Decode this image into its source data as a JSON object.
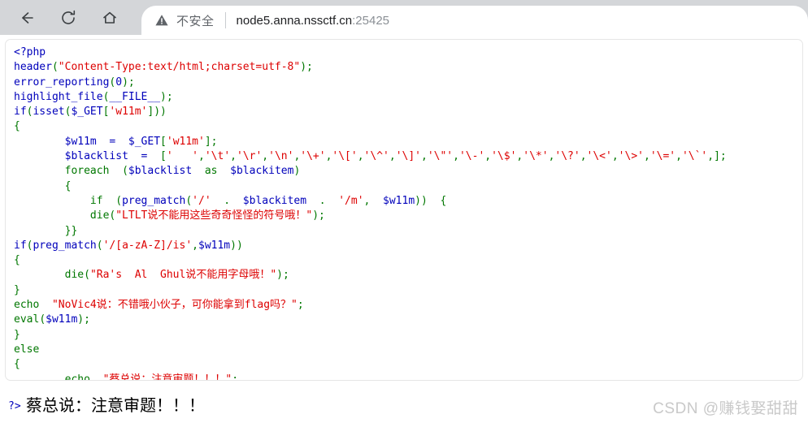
{
  "browser": {
    "back_label": "Back",
    "reload_label": "Reload",
    "home_label": "Home",
    "security_label": "不安全",
    "url_host": "node5.anna.nssctf.cn",
    "url_port": ":25425"
  },
  "code": {
    "lines": [
      [
        {
          "t": "<?php",
          "c": "kw"
        }
      ],
      [
        {
          "t": "header",
          "c": "kw"
        },
        {
          "t": "(",
          "c": "pun"
        },
        {
          "t": "\"Content-Type:text/html;charset=utf-8\"",
          "c": "str"
        },
        {
          "t": ")",
          "c": "pun"
        },
        {
          "t": ";",
          "c": "pun"
        }
      ],
      [
        {
          "t": "error_reporting",
          "c": "kw"
        },
        {
          "t": "(",
          "c": "pun"
        },
        {
          "t": "0",
          "c": "kw"
        },
        {
          "t": ")",
          "c": "pun"
        },
        {
          "t": ";",
          "c": "pun"
        }
      ],
      [
        {
          "t": "highlight_file",
          "c": "kw"
        },
        {
          "t": "(",
          "c": "pun"
        },
        {
          "t": "__FILE__",
          "c": "kw"
        },
        {
          "t": ")",
          "c": "pun"
        },
        {
          "t": ";",
          "c": "pun"
        }
      ],
      [
        {
          "t": "if",
          "c": "kw"
        },
        {
          "t": "(",
          "c": "pun"
        },
        {
          "t": "isset",
          "c": "kw"
        },
        {
          "t": "(",
          "c": "pun"
        },
        {
          "t": "$_GET",
          "c": "var"
        },
        {
          "t": "[",
          "c": "pun"
        },
        {
          "t": "'w11m'",
          "c": "str"
        },
        {
          "t": "]",
          "c": "pun"
        },
        {
          "t": "))",
          "c": "pun"
        }
      ],
      [
        {
          "t": "{",
          "c": "pun"
        }
      ],
      [
        {
          "t": "        ",
          "c": "kw"
        },
        {
          "t": "$w11m",
          "c": "var"
        },
        {
          "t": "  =  ",
          "c": "kw"
        },
        {
          "t": "$_GET",
          "c": "var"
        },
        {
          "t": "[",
          "c": "pun"
        },
        {
          "t": "'w11m'",
          "c": "str"
        },
        {
          "t": "]",
          "c": "pun"
        },
        {
          "t": ";",
          "c": "pun"
        }
      ],
      [
        {
          "t": "        ",
          "c": "kw"
        },
        {
          "t": "$blacklist",
          "c": "var"
        },
        {
          "t": "  =  ",
          "c": "kw"
        },
        {
          "t": "[",
          "c": "pun"
        },
        {
          "t": "'   '",
          "c": "str"
        },
        {
          "t": ",",
          "c": "pun"
        },
        {
          "t": "'\\t'",
          "c": "str"
        },
        {
          "t": ",",
          "c": "pun"
        },
        {
          "t": "'\\r'",
          "c": "str"
        },
        {
          "t": ",",
          "c": "pun"
        },
        {
          "t": "'\\n'",
          "c": "str"
        },
        {
          "t": ",",
          "c": "pun"
        },
        {
          "t": "'\\+'",
          "c": "str"
        },
        {
          "t": ",",
          "c": "pun"
        },
        {
          "t": "'\\['",
          "c": "str"
        },
        {
          "t": ",",
          "c": "pun"
        },
        {
          "t": "'\\^'",
          "c": "str"
        },
        {
          "t": ",",
          "c": "pun"
        },
        {
          "t": "'\\]'",
          "c": "str"
        },
        {
          "t": ",",
          "c": "pun"
        },
        {
          "t": "'\\\"'",
          "c": "str"
        },
        {
          "t": ",",
          "c": "pun"
        },
        {
          "t": "'\\-'",
          "c": "str"
        },
        {
          "t": ",",
          "c": "pun"
        },
        {
          "t": "'\\$'",
          "c": "str"
        },
        {
          "t": ",",
          "c": "pun"
        },
        {
          "t": "'\\*'",
          "c": "str"
        },
        {
          "t": ",",
          "c": "pun"
        },
        {
          "t": "'\\?'",
          "c": "str"
        },
        {
          "t": ",",
          "c": "pun"
        },
        {
          "t": "'\\<'",
          "c": "str"
        },
        {
          "t": ",",
          "c": "pun"
        },
        {
          "t": "'\\>'",
          "c": "str"
        },
        {
          "t": ",",
          "c": "pun"
        },
        {
          "t": "'\\='",
          "c": "str"
        },
        {
          "t": ",",
          "c": "pun"
        },
        {
          "t": "'\\`'",
          "c": "str"
        },
        {
          "t": ",",
          "c": "pun"
        },
        {
          "t": "]",
          "c": "pun"
        },
        {
          "t": ";",
          "c": "pun"
        }
      ],
      [
        {
          "t": "        ",
          "c": "kw"
        },
        {
          "t": "foreach",
          "c": "pun"
        },
        {
          "t": "  (",
          "c": "pun"
        },
        {
          "t": "$blacklist",
          "c": "var"
        },
        {
          "t": "  ",
          "c": "kw"
        },
        {
          "t": "as",
          "c": "pun"
        },
        {
          "t": "  ",
          "c": "kw"
        },
        {
          "t": "$blackitem",
          "c": "var"
        },
        {
          "t": ")",
          "c": "pun"
        }
      ],
      [
        {
          "t": "        {",
          "c": "pun"
        }
      ],
      [
        {
          "t": "            ",
          "c": "kw"
        },
        {
          "t": "if",
          "c": "pun"
        },
        {
          "t": "  (",
          "c": "pun"
        },
        {
          "t": "preg_match",
          "c": "kw"
        },
        {
          "t": "(",
          "c": "pun"
        },
        {
          "t": "'/'",
          "c": "str"
        },
        {
          "t": "  .  ",
          "c": "pun"
        },
        {
          "t": "$blackitem",
          "c": "var"
        },
        {
          "t": "  .  ",
          "c": "pun"
        },
        {
          "t": "'/m'",
          "c": "str"
        },
        {
          "t": ",",
          "c": "pun"
        },
        {
          "t": "  ",
          "c": "kw"
        },
        {
          "t": "$w11m",
          "c": "var"
        },
        {
          "t": "))",
          "c": "pun"
        },
        {
          "t": "  {",
          "c": "pun"
        }
      ],
      [
        {
          "t": "            ",
          "c": "kw"
        },
        {
          "t": "die",
          "c": "pun"
        },
        {
          "t": "(",
          "c": "pun"
        },
        {
          "t": "\"LTLT说不能用这些奇奇怪怪的符号哦！\"",
          "c": "str"
        },
        {
          "t": ")",
          "c": "pun"
        },
        {
          "t": ";",
          "c": "pun"
        }
      ],
      [
        {
          "t": "        }}",
          "c": "pun"
        }
      ],
      [
        {
          "t": "if",
          "c": "kw"
        },
        {
          "t": "(",
          "c": "pun"
        },
        {
          "t": "preg_match",
          "c": "kw"
        },
        {
          "t": "(",
          "c": "pun"
        },
        {
          "t": "'/[a-zA-Z]/is'",
          "c": "str"
        },
        {
          "t": ",",
          "c": "pun"
        },
        {
          "t": "$w11m",
          "c": "var"
        },
        {
          "t": "))",
          "c": "pun"
        }
      ],
      [
        {
          "t": "{",
          "c": "pun"
        }
      ],
      [
        {
          "t": "        ",
          "c": "kw"
        },
        {
          "t": "die",
          "c": "pun"
        },
        {
          "t": "(",
          "c": "pun"
        },
        {
          "t": "\"Ra's  Al  Ghul说不能用字母哦！\"",
          "c": "str"
        },
        {
          "t": ")",
          "c": "pun"
        },
        {
          "t": ";",
          "c": "pun"
        }
      ],
      [
        {
          "t": "}",
          "c": "pun"
        }
      ],
      [
        {
          "t": "echo",
          "c": "pun"
        },
        {
          "t": "  ",
          "c": "kw"
        },
        {
          "t": "\"NoVic4说：不错哦小伙子，可你能拿到flag吗？\"",
          "c": "str"
        },
        {
          "t": ";",
          "c": "pun"
        }
      ],
      [
        {
          "t": "eval",
          "c": "pun"
        },
        {
          "t": "(",
          "c": "pun"
        },
        {
          "t": "$w11m",
          "c": "var"
        },
        {
          "t": ")",
          "c": "pun"
        },
        {
          "t": ";",
          "c": "pun"
        }
      ],
      [
        {
          "t": "}",
          "c": "pun"
        }
      ],
      [
        {
          "t": "else",
          "c": "pun"
        }
      ],
      [
        {
          "t": "{",
          "c": "pun"
        }
      ],
      [
        {
          "t": "        ",
          "c": "kw"
        },
        {
          "t": "echo",
          "c": "pun"
        },
        {
          "t": "  ",
          "c": "kw"
        },
        {
          "t": "\"蔡总说：注意审题！！！\"",
          "c": "str"
        },
        {
          "t": ";",
          "c": "pun"
        }
      ],
      [
        {
          "t": "}",
          "c": "pun"
        }
      ]
    ]
  },
  "output": {
    "php_close": "?>",
    "text": " 蔡总说：注意审题！！！"
  },
  "watermark": {
    "text": "CSDN @赚钱娶甜甜"
  }
}
